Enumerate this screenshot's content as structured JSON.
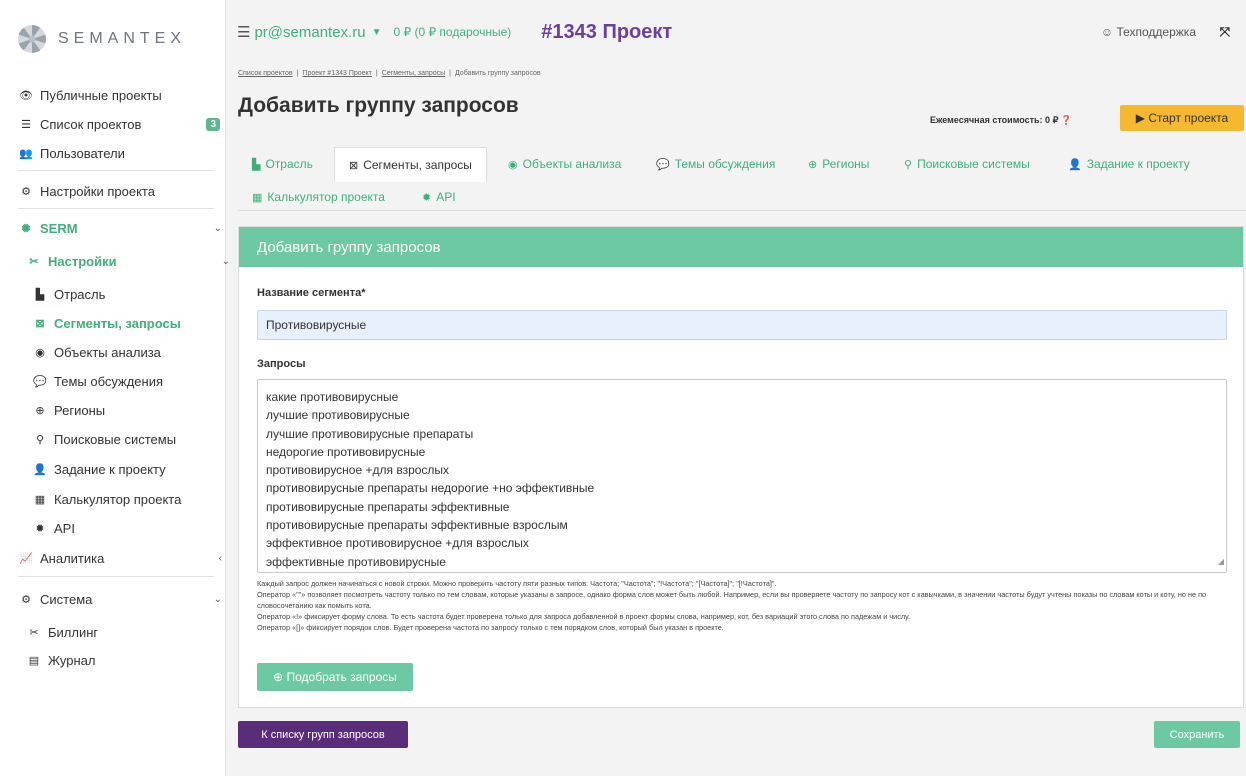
{
  "brand": {
    "name": "SEMANTEX"
  },
  "sidebar": {
    "public_projects": "Публичные проекты",
    "project_list": "Список проектов",
    "project_count": "3",
    "users": "Пользователи",
    "project_settings": "Настройки проекта",
    "serm": "SERM",
    "settings": "Настройки",
    "sub": {
      "industry": "Отрасль",
      "segments": "Сегменты, запросы",
      "objects": "Объекты анализа",
      "topics": "Темы обсуждения",
      "regions": "Регионы",
      "search_engines": "Поисковые системы",
      "task": "Задание к проекту",
      "calculator": "Калькулятор проекта",
      "api": "API"
    },
    "analytics": "Аналитика",
    "system": "Система",
    "billing": "Биллинг",
    "journal": "Журнал"
  },
  "header": {
    "email": "pr@semantex.ru",
    "balance": "0 ₽ (0 ₽ подарочные)",
    "project": "#1343 Проект",
    "support": "Техподдержка"
  },
  "breadcrumb": {
    "items": [
      "Список проектов",
      "Проект #1343 Проект",
      "Сегменты, запросы"
    ],
    "current": "Добавить группу запросов"
  },
  "page": {
    "title": "Добавить группу запросов",
    "monthly_cost": "Ежемесячная стоимость: 0 ₽",
    "start_button": "Старт проекта"
  },
  "tabs": {
    "industry": "Отрасль",
    "segments": "Сегменты, запросы",
    "objects": "Объекты анализа",
    "topics": "Темы обсуждения",
    "regions": "Регионы",
    "search_engines": "Поисковые системы",
    "task": "Задание к проекту",
    "calculator": "Калькулятор проекта",
    "api": "API"
  },
  "form": {
    "panel_title": "Добавить группу запросов",
    "segment_label": "Название сегмента*",
    "segment_value": "Противовирусные",
    "queries_label": "Запросы",
    "queries": [
      "какие противовирусные",
      "лучшие противовирусные",
      "лучшие противовирусные препараты",
      "недорогие противовирусные",
      "противовирусное +для взрослых",
      "противовирусные препараты недорогие +но эффективные",
      "противовирусные препараты эффективные",
      "противовирусные препараты эффективные взрослым",
      "эффективное противовирусное +для взрослых",
      "эффективные противовирусные"
    ],
    "help": [
      "Каждый запрос должен начинаться с новой строки. Можно проверить частоту пяти разных типов: Частота; \"Частота\"; \"!Частота\"; \"[Частота]\"; \"[!Частота]\".",
      "Оператор «\"\"» позволяет посмотреть частоту только по тем словам, которые указаны в запросе, однако форма слов может быть любой. Например, если вы проверяете частоту по запросу кот с кавычками, в значении частоты будут учтены показы по словам коты и коту, но не по словосочетанию как помыть кота.",
      "Оператор «!» фиксирует форму слова. То есть частота будет проверена только для запроса добавленной в проект формы слова, например, кот, без вариаций этого слова по падежам и числу.",
      "Оператор «[]» фиксирует порядок слов. Будет проверена частота по запросу только с тем порядком слов, который был указан в проекте."
    ],
    "pick_button": "Подобрать запросы"
  },
  "footer": {
    "back_button": "К списку групп запросов",
    "save_button": "Сохранить"
  },
  "colors": {
    "accent": "#3fb07b",
    "panel_header": "#6dc9a4",
    "purple": "#5a2d7a",
    "warning": "#f5b82e"
  }
}
